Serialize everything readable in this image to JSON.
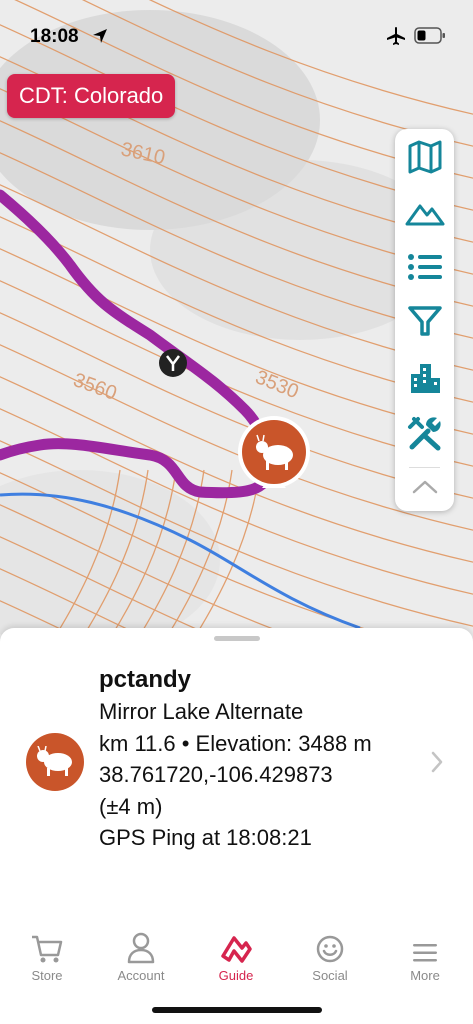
{
  "status_bar": {
    "time": "18:08",
    "location_icon": "location-arrow-icon",
    "airplane_icon": "airplane-icon",
    "battery_icon": "battery-icon"
  },
  "map": {
    "region_label": "CDT: Colorado",
    "contour_labels": [
      "3610",
      "3560",
      "3530"
    ],
    "colors": {
      "trail": "#9c27a0",
      "contour": "#e0925a",
      "stream": "#3f7fe0",
      "pin": "#c9552a"
    }
  },
  "toolbar": {
    "buttons": [
      "map-icon",
      "mountains-icon",
      "list-icon",
      "filter-icon",
      "buildings-icon",
      "tools-icon",
      "chevron-up-icon"
    ]
  },
  "sheet": {
    "user": "pctandy",
    "route": "Mirror Lake Alternate",
    "km_elev": "km 11.6 • Elevation: 3488 m",
    "coords": "38.761720,-106.429873",
    "accuracy": "(±4 m)",
    "ping": "GPS Ping at 18:08:21"
  },
  "tabs": [
    {
      "label": "Store",
      "icon": "cart-icon"
    },
    {
      "label": "Account",
      "icon": "person-icon"
    },
    {
      "label": "Guide",
      "icon": "guide-logo-icon",
      "active": true
    },
    {
      "label": "Social",
      "icon": "smiley-icon"
    },
    {
      "label": "More",
      "icon": "menu-icon"
    }
  ]
}
